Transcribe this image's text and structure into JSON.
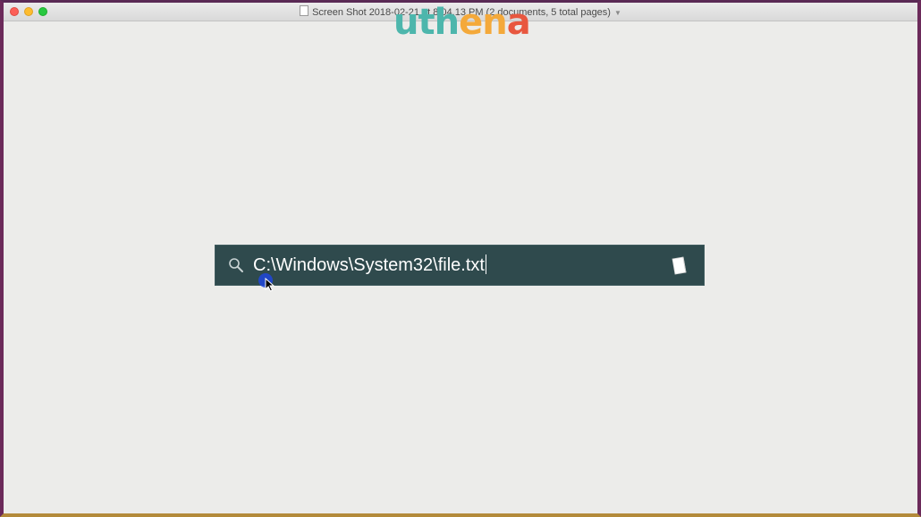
{
  "window": {
    "title": "Screen Shot 2018-02-21 at 8.04.13 PM (2 documents, 5 total pages)"
  },
  "logo": {
    "letters": [
      "u",
      "t",
      "h",
      "e",
      "n",
      "a"
    ],
    "colors": [
      "#4db6ac",
      "#4db6ac",
      "#4db6ac",
      "#f4a93a",
      "#f4a93a",
      "#e8573f"
    ]
  },
  "spotlight": {
    "query": "C:\\Windows\\System32\\file.txt",
    "icon": "search-icon",
    "result_icon": "notes-document-icon",
    "accent": "#2f4a4d"
  }
}
